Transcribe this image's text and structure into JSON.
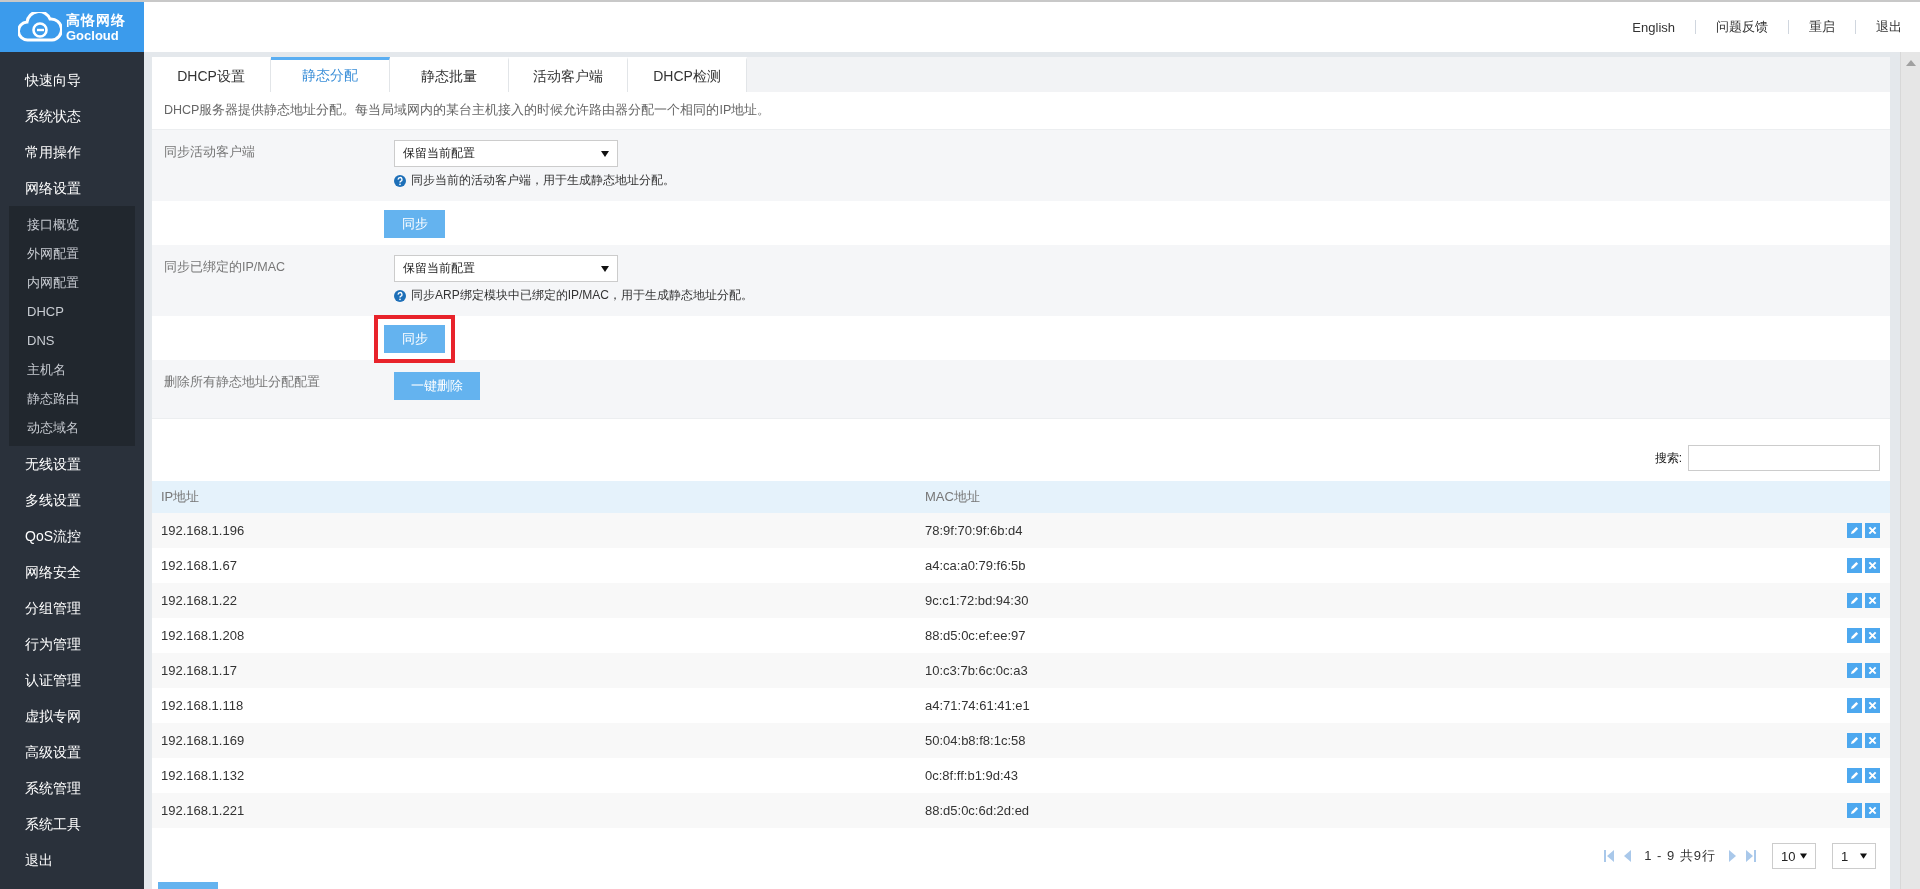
{
  "logo": {
    "name": "高恪网络",
    "subtitle": "Gocloud"
  },
  "header_links": [
    "English",
    "问题反馈",
    "重启",
    "退出"
  ],
  "sidebar": {
    "items": [
      {
        "label": "快速向导"
      },
      {
        "label": "系统状态"
      },
      {
        "label": "常用操作"
      },
      {
        "label": "网络设置",
        "children": [
          {
            "label": "接口概览"
          },
          {
            "label": "外网配置"
          },
          {
            "label": "内网配置"
          },
          {
            "label": "DHCP"
          },
          {
            "label": "DNS"
          },
          {
            "label": "主机名"
          },
          {
            "label": "静态路由"
          },
          {
            "label": "动态域名"
          }
        ]
      },
      {
        "label": "无线设置"
      },
      {
        "label": "多线设置"
      },
      {
        "label": "QoS流控"
      },
      {
        "label": "网络安全"
      },
      {
        "label": "分组管理"
      },
      {
        "label": "行为管理"
      },
      {
        "label": "认证管理"
      },
      {
        "label": "虚拟专网"
      },
      {
        "label": "高级设置"
      },
      {
        "label": "系统管理"
      },
      {
        "label": "系统工具"
      },
      {
        "label": "退出"
      }
    ]
  },
  "tabs": [
    {
      "label": "DHCP设置",
      "selected": false
    },
    {
      "label": "静态分配",
      "selected": true
    },
    {
      "label": "静态批量",
      "selected": false
    },
    {
      "label": "活动客户端",
      "selected": false
    },
    {
      "label": "DHCP检测",
      "selected": false
    }
  ],
  "description": "DHCP服务器提供静态地址分配。每当局域网内的某台主机接入的时候允许路由器分配一个相同的IP地址。",
  "form_rows": [
    {
      "kind": "select",
      "label": "同步活动客户端",
      "value": "保留当前配置",
      "help": "同步当前的活动客户端，用于生成静态地址分配。"
    },
    {
      "kind": "button",
      "button": "同步",
      "highlighted": false
    },
    {
      "kind": "select",
      "label": "同步已绑定的IP/MAC",
      "value": "保留当前配置",
      "help": "同步ARP绑定模块中已绑定的IP/MAC，用于生成静态地址分配。"
    },
    {
      "kind": "button",
      "button": "同步",
      "highlighted": true
    },
    {
      "kind": "button",
      "label": "删除所有静态地址分配配置",
      "button": "一键删除",
      "highlighted": false
    }
  ],
  "search": {
    "label": "搜索:"
  },
  "table": {
    "columns": [
      "IP地址",
      "MAC地址"
    ],
    "rows": [
      [
        "192.168.1.196",
        "78:9f:70:9f:6b:d4"
      ],
      [
        "192.168.1.67",
        "a4:ca:a0:79:f6:5b"
      ],
      [
        "192.168.1.22",
        "9c:c1:72:bd:94:30"
      ],
      [
        "192.168.1.208",
        "88:d5:0c:ef:ee:97"
      ],
      [
        "192.168.1.17",
        "10:c3:7b:6c:0c:a3"
      ],
      [
        "192.168.1.118",
        "a4:71:74:61:41:e1"
      ],
      [
        "192.168.1.169",
        "50:04:b8:f8:1c:58"
      ],
      [
        "192.168.1.132",
        "0c:8f:ff:b1:9d:43"
      ],
      [
        "192.168.1.221",
        "88:d5:0c:6d:2d:ed"
      ]
    ]
  },
  "pagination": {
    "summary": "1 - 9 共9行",
    "page_size": "10",
    "page": "1"
  }
}
